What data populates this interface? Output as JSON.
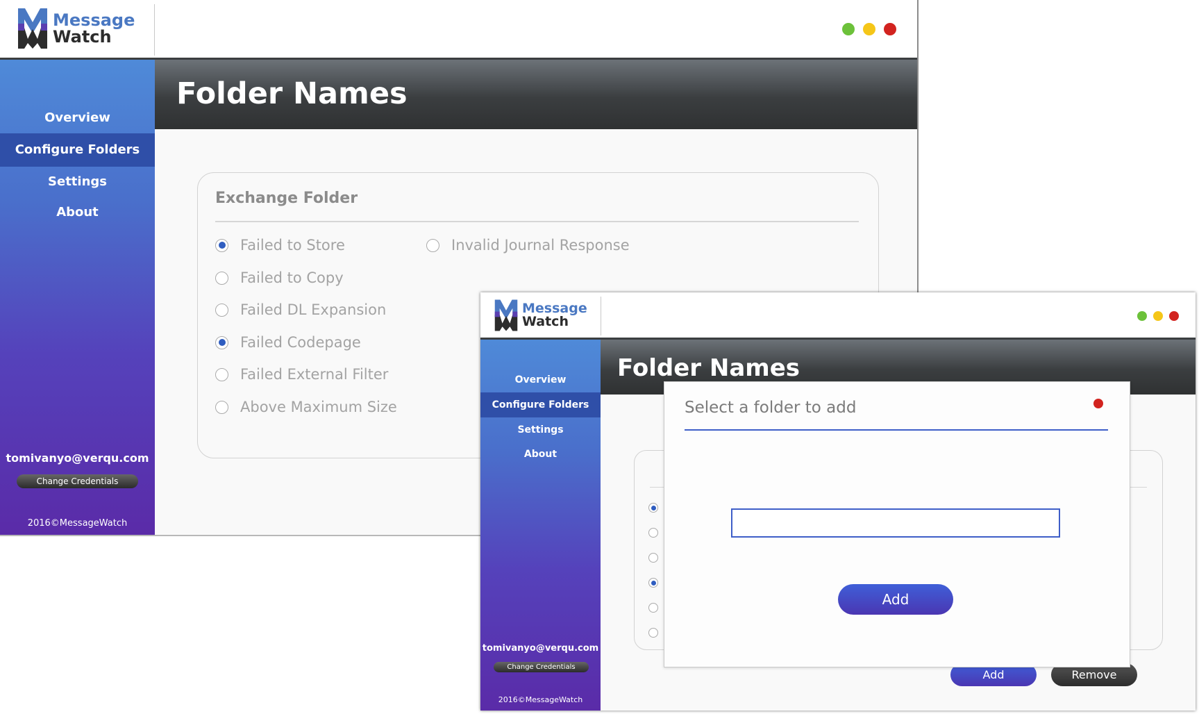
{
  "colors": {
    "dot_green": "#6cc13a",
    "dot_yellow": "#f5c618",
    "dot_red": "#d2231f",
    "accent_blue": "#2f5dc0"
  },
  "window_main": {
    "logo": {
      "line1": "Message",
      "line2": "Watch",
      "icon": "messagewatch-logo-icon"
    },
    "page_title": "Folder Names",
    "nav": [
      "Overview",
      "Configure Folders",
      "Settings",
      "About"
    ],
    "active_nav": "Configure Folders",
    "user_email": "tomivanyo@verqu.com",
    "change_credentials_label": "Change Credentials",
    "copyright": "2016©MessageWatch",
    "panel_title": "Exchange Folder",
    "options": [
      {
        "label": "Failed to Store",
        "checked": true
      },
      {
        "label": "Failed to Copy",
        "checked": false
      },
      {
        "label": "Failed DL Expansion",
        "checked": false
      },
      {
        "label": "Failed Codepage",
        "checked": true
      },
      {
        "label": "Failed External Filter",
        "checked": false
      },
      {
        "label": "Above Maximum Size",
        "checked": false
      },
      {
        "label": "Invalid Journal Response",
        "checked": false
      }
    ]
  },
  "window_second": {
    "logo": {
      "line1": "Message",
      "line2": "Watch",
      "icon": "messagewatch-logo-icon"
    },
    "page_title": "Folder Names",
    "nav": [
      "Overview",
      "Configure Folders",
      "Settings",
      "About"
    ],
    "active_nav": "Configure Folders",
    "user_email": "tomivanyo@verqu.com",
    "change_credentials_label": "Change Credentials",
    "copyright": "2016©MessageWatch",
    "background_radios_checked": [
      true,
      false,
      false,
      true,
      false,
      false
    ],
    "add_label": "Add",
    "remove_label": "Remove",
    "modal": {
      "title": "Select a folder to add",
      "input_value": "",
      "add_label": "Add",
      "close_icon": "close-dot-icon"
    }
  }
}
